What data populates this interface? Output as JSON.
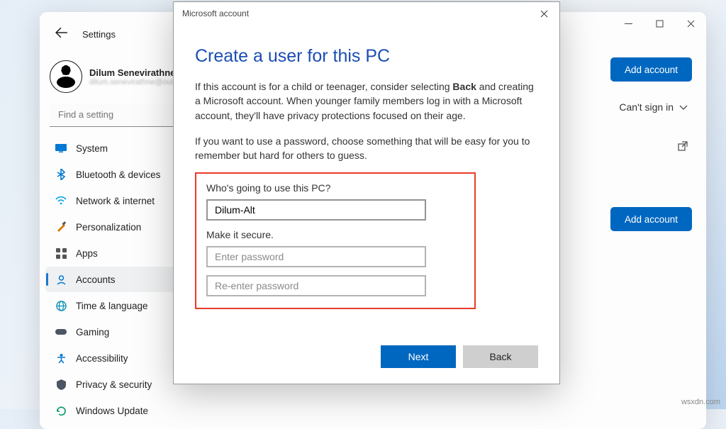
{
  "settings": {
    "title": "Settings",
    "profile": {
      "name": "Dilum Senevirathne",
      "email": "dilum.senevirathne@out..."
    },
    "search_placeholder": "Find a setting",
    "nav": [
      {
        "label": "System"
      },
      {
        "label": "Bluetooth & devices"
      },
      {
        "label": "Network & internet"
      },
      {
        "label": "Personalization"
      },
      {
        "label": "Apps"
      },
      {
        "label": "Accounts"
      },
      {
        "label": "Time & language"
      },
      {
        "label": "Gaming"
      },
      {
        "label": "Accessibility"
      },
      {
        "label": "Privacy & security"
      },
      {
        "label": "Windows Update"
      }
    ]
  },
  "content": {
    "add_account": "Add account",
    "cant_sign_in": "Can't sign in"
  },
  "modal": {
    "window_title": "Microsoft account",
    "heading": "Create a user for this PC",
    "para1_a": "If this account is for a child or teenager, consider selecting ",
    "para1_bold": "Back",
    "para1_b": " and creating a Microsoft account. When younger family members log in with a Microsoft account, they'll have privacy protections focused on their age.",
    "para2": "If you want to use a password, choose something that will be easy for you to remember but hard for others to guess.",
    "q_user": "Who's going to use this PC?",
    "username_value": "Dilum-Alt",
    "q_secure": "Make it secure.",
    "pw_placeholder": "Enter password",
    "pw2_placeholder": "Re-enter password",
    "next": "Next",
    "back": "Back"
  },
  "watermark": "wsxdn.com"
}
